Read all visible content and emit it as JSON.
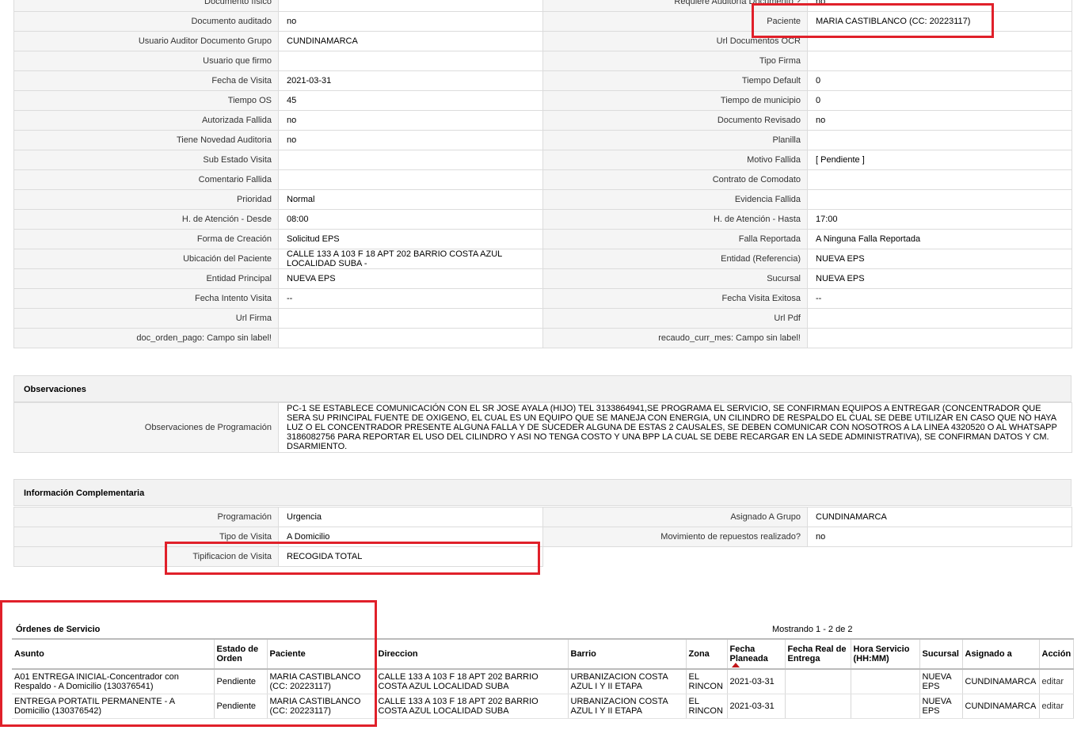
{
  "details": {
    "rows": [
      {
        "l1": "Documento físico",
        "v1": "",
        "l2": "Requiere Auditoría Documento ?",
        "v2": "no"
      },
      {
        "l1": "Documento auditado",
        "v1": "no",
        "l2": "Paciente",
        "v2": "MARIA CASTIBLANCO (CC: 20223117)"
      },
      {
        "l1": "Usuario Auditor Documento Grupo",
        "v1": "CUNDINAMARCA",
        "l2": "Url Documentos OCR",
        "v2": ""
      },
      {
        "l1": "Usuario que firmo",
        "v1": "",
        "l2": "Tipo Firma",
        "v2": ""
      },
      {
        "l1": "Fecha de Visita",
        "v1": "2021-03-31",
        "l2": "Tiempo Default",
        "v2": "0"
      },
      {
        "l1": "Tiempo OS",
        "v1": "45",
        "l2": "Tiempo de municipio",
        "v2": "0"
      },
      {
        "l1": "Autorizada Fallida",
        "v1": "no",
        "l2": "Documento Revisado",
        "v2": "no"
      },
      {
        "l1": "Tiene Novedad Auditoria",
        "v1": "no",
        "l2": "Planilla",
        "v2": ""
      },
      {
        "l1": "Sub Estado Visita",
        "v1": "",
        "l2": "Motivo Fallida",
        "v2": "[ Pendiente ]"
      },
      {
        "l1": "Comentario Fallida",
        "v1": "",
        "l2": "Contrato de Comodato",
        "v2": ""
      },
      {
        "l1": "Prioridad",
        "v1": "Normal",
        "l2": "Evidencia Fallida",
        "v2": ""
      },
      {
        "l1": "H. de Atención - Desde",
        "v1": "08:00",
        "l2": "H. de Atención - Hasta",
        "v2": "17:00"
      },
      {
        "l1": "Forma de Creación",
        "v1": "Solicitud EPS",
        "l2": "Falla Reportada",
        "v2": "A Ninguna Falla Reportada"
      },
      {
        "l1": "Ubicación del Paciente",
        "v1": "CALLE 133 A 103 F 18 APT 202 BARRIO COSTA AZUL LOCALIDAD SUBA -",
        "l2": "Entidad (Referencia)",
        "v2": "NUEVA EPS"
      },
      {
        "l1": "Entidad Principal",
        "v1": "NUEVA EPS",
        "l2": "Sucursal",
        "v2": "NUEVA EPS"
      },
      {
        "l1": "Fecha Intento Visita",
        "v1": "--",
        "l2": "Fecha Visita Exitosa",
        "v2": "--"
      },
      {
        "l1": "Url Firma",
        "v1": "",
        "l2": "Url Pdf",
        "v2": ""
      },
      {
        "l1": "doc_orden_pago: Campo sin label!",
        "v1": "",
        "l2": "recaudo_curr_mes: Campo sin label!",
        "v2": ""
      }
    ]
  },
  "observaciones": {
    "title": "Observaciones",
    "label": "Observaciones de Programación",
    "text": "PC-1 SE ESTABLECE COMUNICACIÓN CON EL SR JOSE AYALA (HIJO) TEL 3133864941,SE PROGRAMA EL SERVICIO, SE CONFIRMAN EQUIPOS A ENTREGAR (CONCENTRADOR QUE SERA SU PRINCIPAL FUENTE DE OXIGENO, EL CUAL ES UN EQUIPO QUE SE MANEJA CON ENERGIA, UN CILINDRO DE RESPALDO EL CUAL SE DEBE UTILIZAR EN CASO QUE NO HAYA LUZ O EL CONCENTRADOR PRESENTE ALGUNA FALLA Y DE SUCEDER ALGUNA DE ESTAS 2 CAUSALES, SE DEBEN COMUNICAR CON NOSOTROS A LA LINEA 4320520 O AL WHATSAPP 3186082756 PARA REPORTAR EL USO DEL CILINDRO Y ASI NO TENGA COSTO Y UNA BPP LA CUAL SE DEBE RECARGAR EN LA SEDE ADMINISTRATIVA), SE CONFIRMAN DATOS Y CM. DSARMIENTO."
  },
  "complementaria": {
    "title": "Información Complementaria",
    "rows": [
      {
        "l1": "Programación",
        "v1": "Urgencia",
        "l2": "Asignado A Grupo",
        "v2": "CUNDINAMARCA"
      },
      {
        "l1": "Tipo de Visita",
        "v1": "A Domicilio",
        "l2": "Movimiento de repuestos realizado?",
        "v2": "no"
      }
    ],
    "tipificacion_label": "Tipificacion de Visita",
    "tipificacion_value": "RECOGIDA TOTAL"
  },
  "ordenes": {
    "title": "Órdenes de Servicio",
    "showing": "Mostrando 1 - 2 de 2",
    "headers": {
      "asunto": "Asunto",
      "estado": "Estado de Orden",
      "paciente": "Paciente",
      "direccion": "Direccion",
      "barrio": "Barrio",
      "zona": "Zona",
      "fecha_planeada": "Fecha Planeada",
      "fecha_real": "Fecha Real de Entrega",
      "hora": "Hora Servicio (HH:MM)",
      "sucursal": "Sucursal",
      "asignado": "Asignado a",
      "accion": "Acción"
    },
    "rows": [
      {
        "asunto": "A01 ENTREGA INICIAL-Concentrador con Respaldo - A Domicilio (130376541)",
        "estado": "Pendiente",
        "paciente": "MARIA CASTIBLANCO (CC: 20223117)",
        "direccion": "CALLE 133 A 103 F 18 APT 202 BARRIO COSTA AZUL LOCALIDAD SUBA",
        "barrio": "URBANIZACION COSTA AZUL I Y II ETAPA",
        "zona": "EL RINCON",
        "fecha_planeada": "2021-03-31",
        "fecha_real": "",
        "hora": "",
        "sucursal": "NUEVA EPS",
        "asignado": "CUNDINAMARCA",
        "accion": "editar"
      },
      {
        "asunto": "ENTREGA PORTATIL PERMANENTE - A Domicilio (130376542)",
        "estado": "Pendiente",
        "paciente": "MARIA CASTIBLANCO (CC: 20223117)",
        "direccion": "CALLE 133 A 103 F 18 APT 202 BARRIO COSTA AZUL LOCALIDAD SUBA",
        "barrio": "URBANIZACION COSTA AZUL I Y II ETAPA",
        "zona": "EL RINCON",
        "fecha_planeada": "2021-03-31",
        "fecha_real": "",
        "hora": "",
        "sucursal": "NUEVA EPS",
        "asignado": "CUNDINAMARCA",
        "accion": "editar"
      }
    ]
  },
  "colors": {
    "highlight": "#e0202a",
    "label_bg": "#f5f5f5",
    "header_bg": "#f2f2f2"
  }
}
